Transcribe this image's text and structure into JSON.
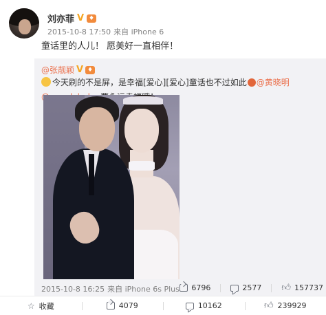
{
  "post": {
    "author": "刘亦菲",
    "verified_badge": "V",
    "timestamp": "2015-10-8 17:50",
    "source": "来自 iPhone 6",
    "text": "童话里的人儿！ 愿美好一直相伴！"
  },
  "repost": {
    "author": "@张靓颖",
    "verified_badge": "V",
    "text_part1": "今天刷的不是屏，是幸福[爱心][爱心]童话也不过如此",
    "mention1": "@黄晓明",
    "mention2": "@angelababy",
    "text_part2": "要永远幸福哦！",
    "timestamp": "2015-10-8 16:25",
    "source": "来自 iPhone 6s Plus",
    "stats": {
      "shares": "6796",
      "comments": "2577",
      "likes": "157737"
    }
  },
  "footer": {
    "favorite_label": "收藏",
    "share_count": "4079",
    "comment_count": "10162",
    "like_count": "239929"
  },
  "colors": {
    "accent": "#eb7350",
    "verified": "#f5a623",
    "meta_text": "#808080",
    "repost_bg": "#f2f2f5"
  },
  "icons": [
    "share-icon",
    "comment-icon",
    "like-icon",
    "star-icon",
    "verified-icon",
    "emoji-icon"
  ]
}
